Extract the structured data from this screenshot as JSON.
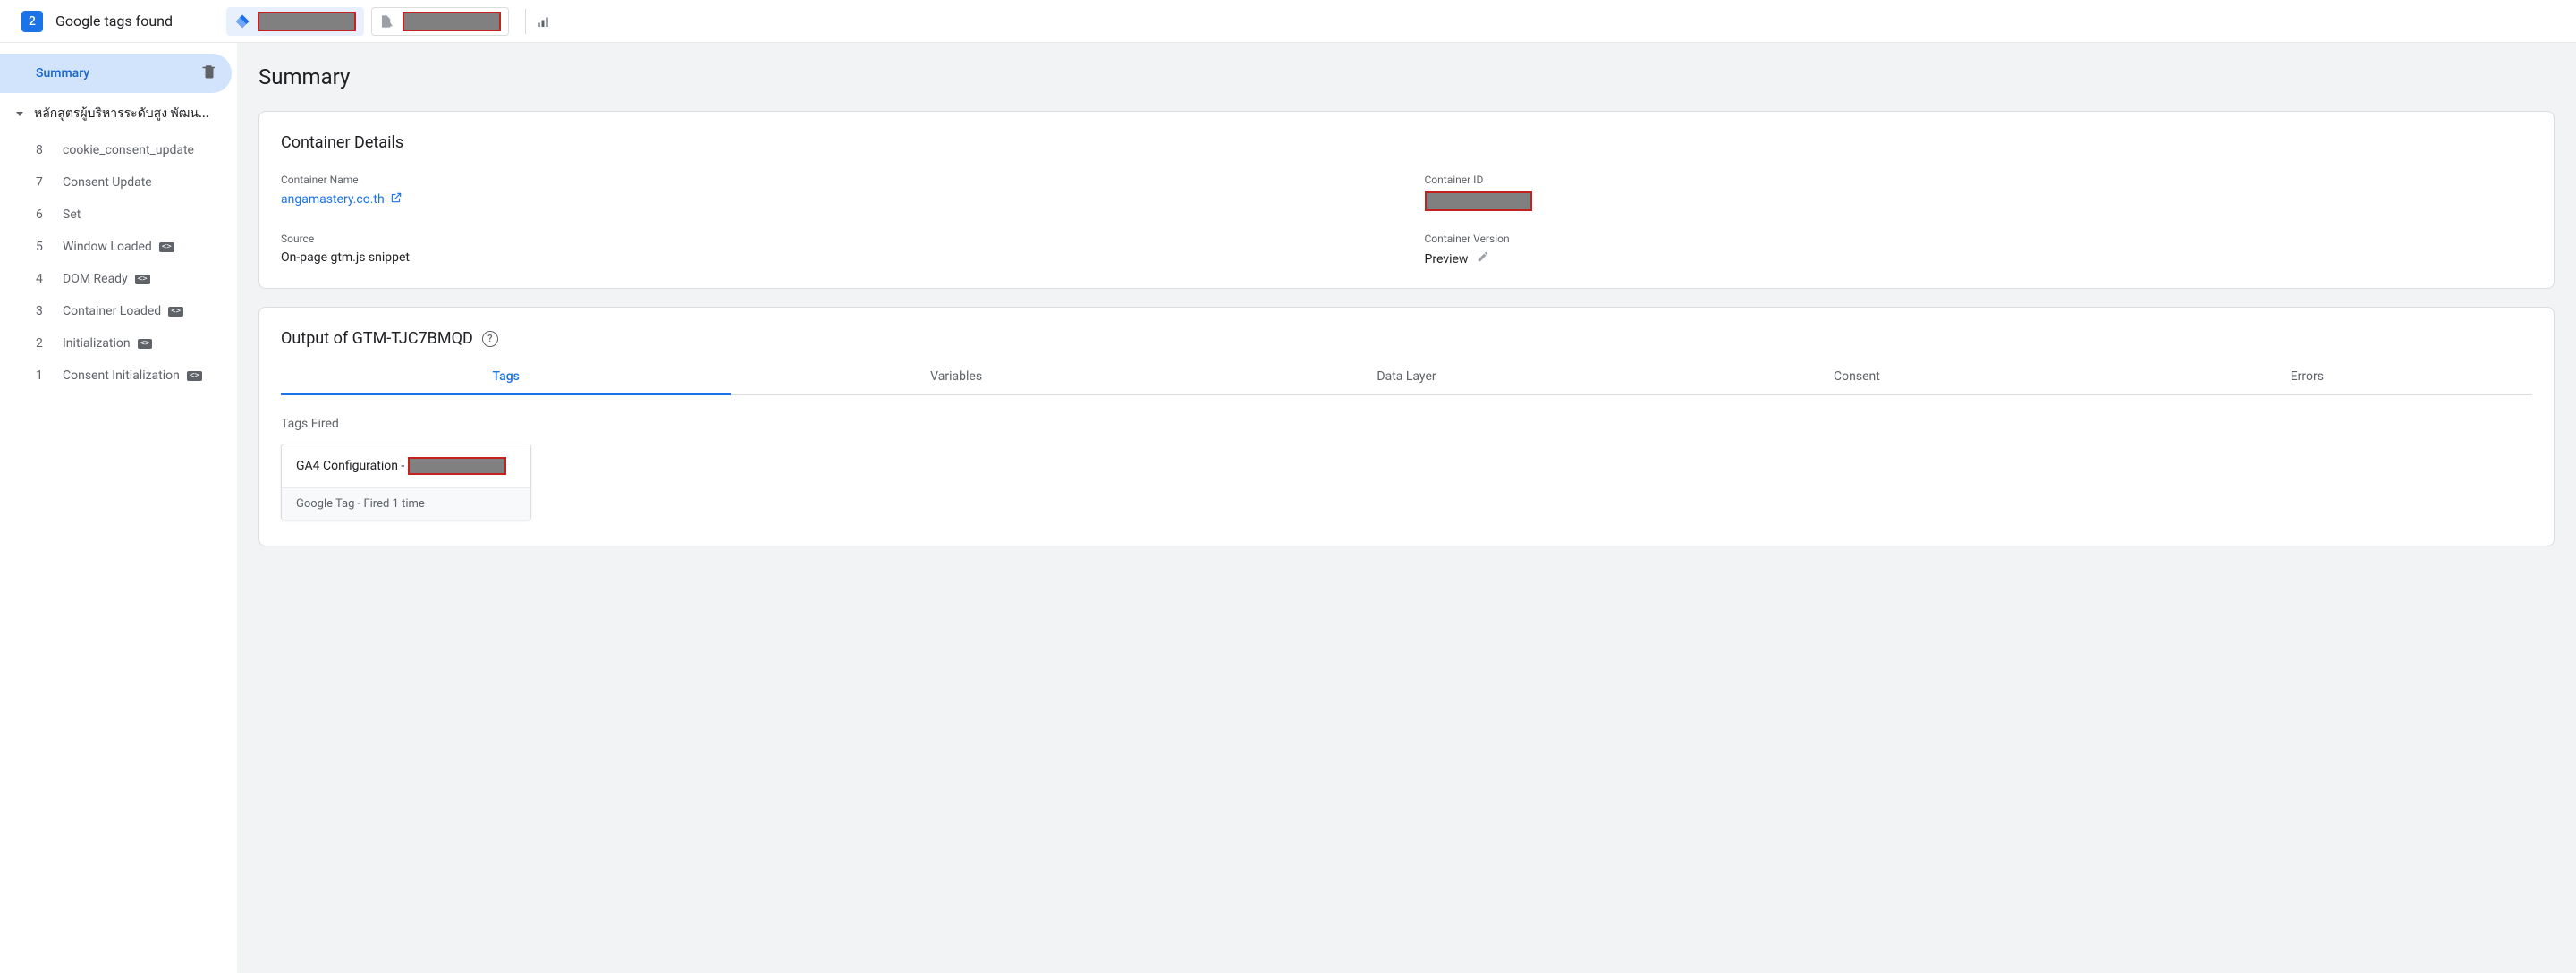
{
  "header": {
    "count": "2",
    "title": "Google tags found"
  },
  "sidebar": {
    "summary_label": "Summary",
    "tree_title": "หลักสูตรผู้บริหารระดับสูง พัฒน...",
    "events": [
      {
        "num": "8",
        "name": "cookie_consent_update",
        "code": false
      },
      {
        "num": "7",
        "name": "Consent Update",
        "code": false
      },
      {
        "num": "6",
        "name": "Set",
        "code": false
      },
      {
        "num": "5",
        "name": "Window Loaded",
        "code": true
      },
      {
        "num": "4",
        "name": "DOM Ready",
        "code": true
      },
      {
        "num": "3",
        "name": "Container Loaded",
        "code": true
      },
      {
        "num": "2",
        "name": "Initialization",
        "code": true
      },
      {
        "num": "1",
        "name": "Consent Initialization",
        "code": true
      }
    ]
  },
  "main": {
    "page_title": "Summary",
    "container_details": {
      "heading": "Container Details",
      "name_label": "Container Name",
      "name_value": "angamastery.co.th",
      "id_label": "Container ID",
      "source_label": "Source",
      "source_value": "On-page gtm.js snippet",
      "version_label": "Container Version",
      "version_value": "Preview"
    },
    "output": {
      "heading": "Output of GTM-TJC7BMQD",
      "tabs": [
        "Tags",
        "Variables",
        "Data Layer",
        "Consent",
        "Errors"
      ],
      "active_tab": 0,
      "fired_label": "Tags Fired",
      "tag_card": {
        "title_prefix": "GA4 Configuration -",
        "subtitle": "Google Tag - Fired 1 time"
      }
    }
  }
}
